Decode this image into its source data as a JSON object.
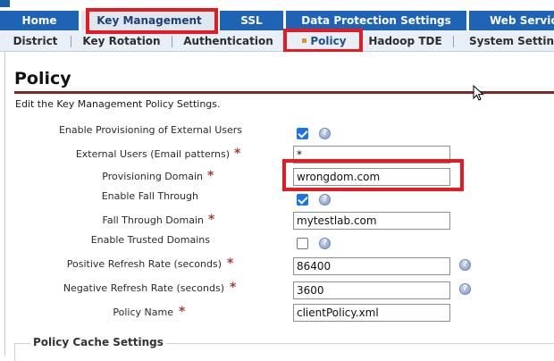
{
  "main_tabs": [
    {
      "label": "Home"
    },
    {
      "label": "Key Management"
    },
    {
      "label": "SSL"
    },
    {
      "label": "Data Protection Settings"
    },
    {
      "label": "Web Services"
    }
  ],
  "sub_tabs": [
    {
      "label": "District"
    },
    {
      "label": "Key Rotation"
    },
    {
      "label": "Authentication"
    },
    {
      "label": "Policy"
    },
    {
      "label": "Hadoop TDE"
    },
    {
      "label": "System Settings"
    }
  ],
  "page": {
    "title": "Policy",
    "description": "Edit the Key Management Policy Settings."
  },
  "form": {
    "enable_provisioning_label": "Enable Provisioning of External Users",
    "enable_provisioning_checked": true,
    "external_users_label": "External Users (Email patterns)",
    "external_users_value": "*",
    "provisioning_domain_label": "Provisioning Domain",
    "provisioning_domain_value": "wrongdom.com",
    "enable_fall_through_label": "Enable Fall Through",
    "enable_fall_through_checked": true,
    "fall_through_domain_label": "Fall Through Domain",
    "fall_through_domain_value": "mytestlab.com",
    "enable_trusted_domains_label": "Enable Trusted Domains",
    "enable_trusted_domains_checked": false,
    "positive_refresh_label": "Positive Refresh Rate (seconds)",
    "positive_refresh_value": "86400",
    "negative_refresh_label": "Negative Refresh Rate (seconds)",
    "negative_refresh_value": "3600",
    "policy_name_label": "Policy Name",
    "policy_name_value": "clientPolicy.xml",
    "required_mark": "*",
    "help_glyph": "?"
  },
  "sections": {
    "policy_cache_title": "Policy Cache Settings"
  },
  "colors": {
    "tab_blue": "#1f64b4",
    "highlight_red": "#e41b23",
    "title_rule": "#7b2a25",
    "required_red": "#b5372f"
  }
}
